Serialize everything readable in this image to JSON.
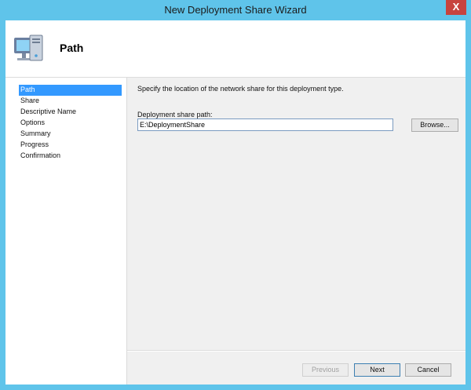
{
  "window": {
    "title": "New Deployment Share Wizard",
    "close_label": "X"
  },
  "header": {
    "title": "Path",
    "icon": "computer-icon"
  },
  "sidebar": {
    "steps": [
      {
        "label": "Path",
        "active": true
      },
      {
        "label": "Share",
        "active": false
      },
      {
        "label": "Descriptive Name",
        "active": false
      },
      {
        "label": "Options",
        "active": false
      },
      {
        "label": "Summary",
        "active": false
      },
      {
        "label": "Progress",
        "active": false
      },
      {
        "label": "Confirmation",
        "active": false
      }
    ]
  },
  "content": {
    "instruction": "Specify the location of the network share for this deployment type.",
    "path_label": "Deployment share path:",
    "path_value": "E:\\DeploymentShare",
    "browse_label": "Browse..."
  },
  "footer": {
    "previous_label": "Previous",
    "next_label": "Next",
    "cancel_label": "Cancel"
  },
  "colors": {
    "frame": "#5fc4ea",
    "selection": "#3399ff",
    "close": "#c7433e"
  }
}
